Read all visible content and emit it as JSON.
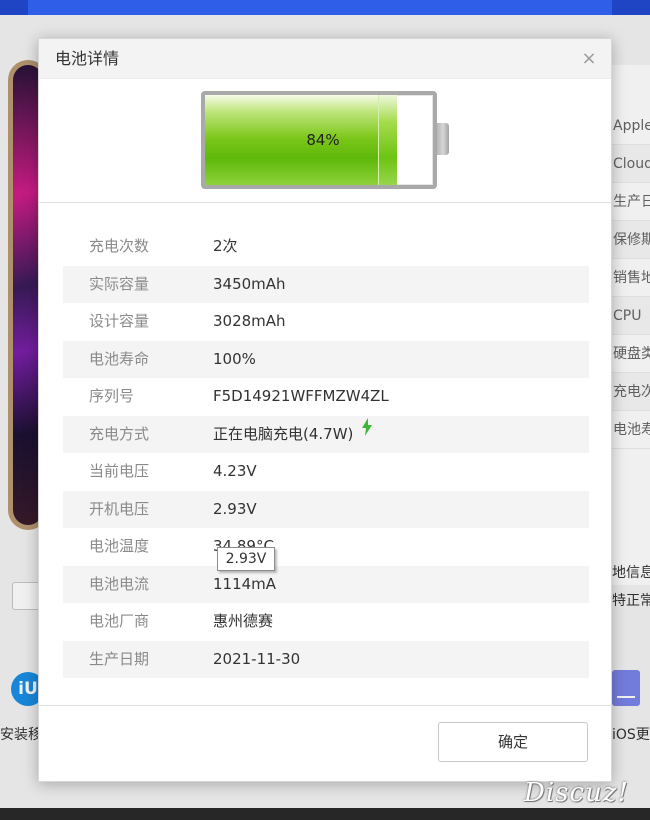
{
  "background": {
    "right_panel_items": [
      "Apple",
      "Cloud",
      "生产日",
      "保修期",
      "销售地",
      "CPU",
      "硬盘类",
      "充电次",
      "电池寿"
    ],
    "right_extra": [
      "地信息之",
      "特正常"
    ],
    "bottom_left_label": "安装移",
    "bottom_right_label": "iOS更",
    "left_logo_text": "iU",
    "watermark": "Discuz!"
  },
  "dialog": {
    "title": "电池详情",
    "close_symbol": "×",
    "battery": {
      "percent_label": "84%",
      "level": 0.84,
      "fill_color": "#6cc014"
    },
    "rows": [
      {
        "key": "充电次数",
        "value": "2次"
      },
      {
        "key": "实际容量",
        "value": "3450mAh"
      },
      {
        "key": "设计容量",
        "value": "3028mAh"
      },
      {
        "key": "电池寿命",
        "value": "100%"
      },
      {
        "key": "序列号",
        "value": "F5D14921WFFMZW4ZL"
      },
      {
        "key": "充电方式",
        "value": "正在电脑充电(4.7W)",
        "icon": "lightning-bolt-icon"
      },
      {
        "key": "当前电压",
        "value": "4.23V"
      },
      {
        "key": "开机电压",
        "value": "2.93V"
      },
      {
        "key": "电池温度",
        "value": "34.89°C"
      },
      {
        "key": "电池电流",
        "value": "1114mA"
      },
      {
        "key": "电池厂商",
        "value": "惠州德赛"
      },
      {
        "key": "生产日期",
        "value": "2021-11-30"
      }
    ],
    "tooltip": "2.93V",
    "ok_label": "确定"
  }
}
